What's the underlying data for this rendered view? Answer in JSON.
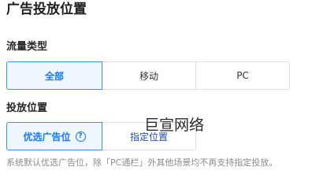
{
  "page_title": "广告投放位置",
  "traffic_type": {
    "label": "流量类型",
    "options": [
      "全部",
      "移动",
      "PC"
    ],
    "selected": "全部"
  },
  "placement": {
    "label": "投放位置",
    "options": [
      "优选广告位",
      "指定位置"
    ],
    "selected": "优选广告位",
    "help_icon": "question-circle-icon",
    "help_glyph": "?"
  },
  "watermark": "巨宣网络",
  "note": "系统默认优选广告位，除「PC通栏」外其他场景均不再支持指定投放。",
  "colors": {
    "accent": "#1677ff",
    "selected_bg": "#eef6ff",
    "border": "#dcdfe6",
    "note": "#8c8c8c"
  }
}
